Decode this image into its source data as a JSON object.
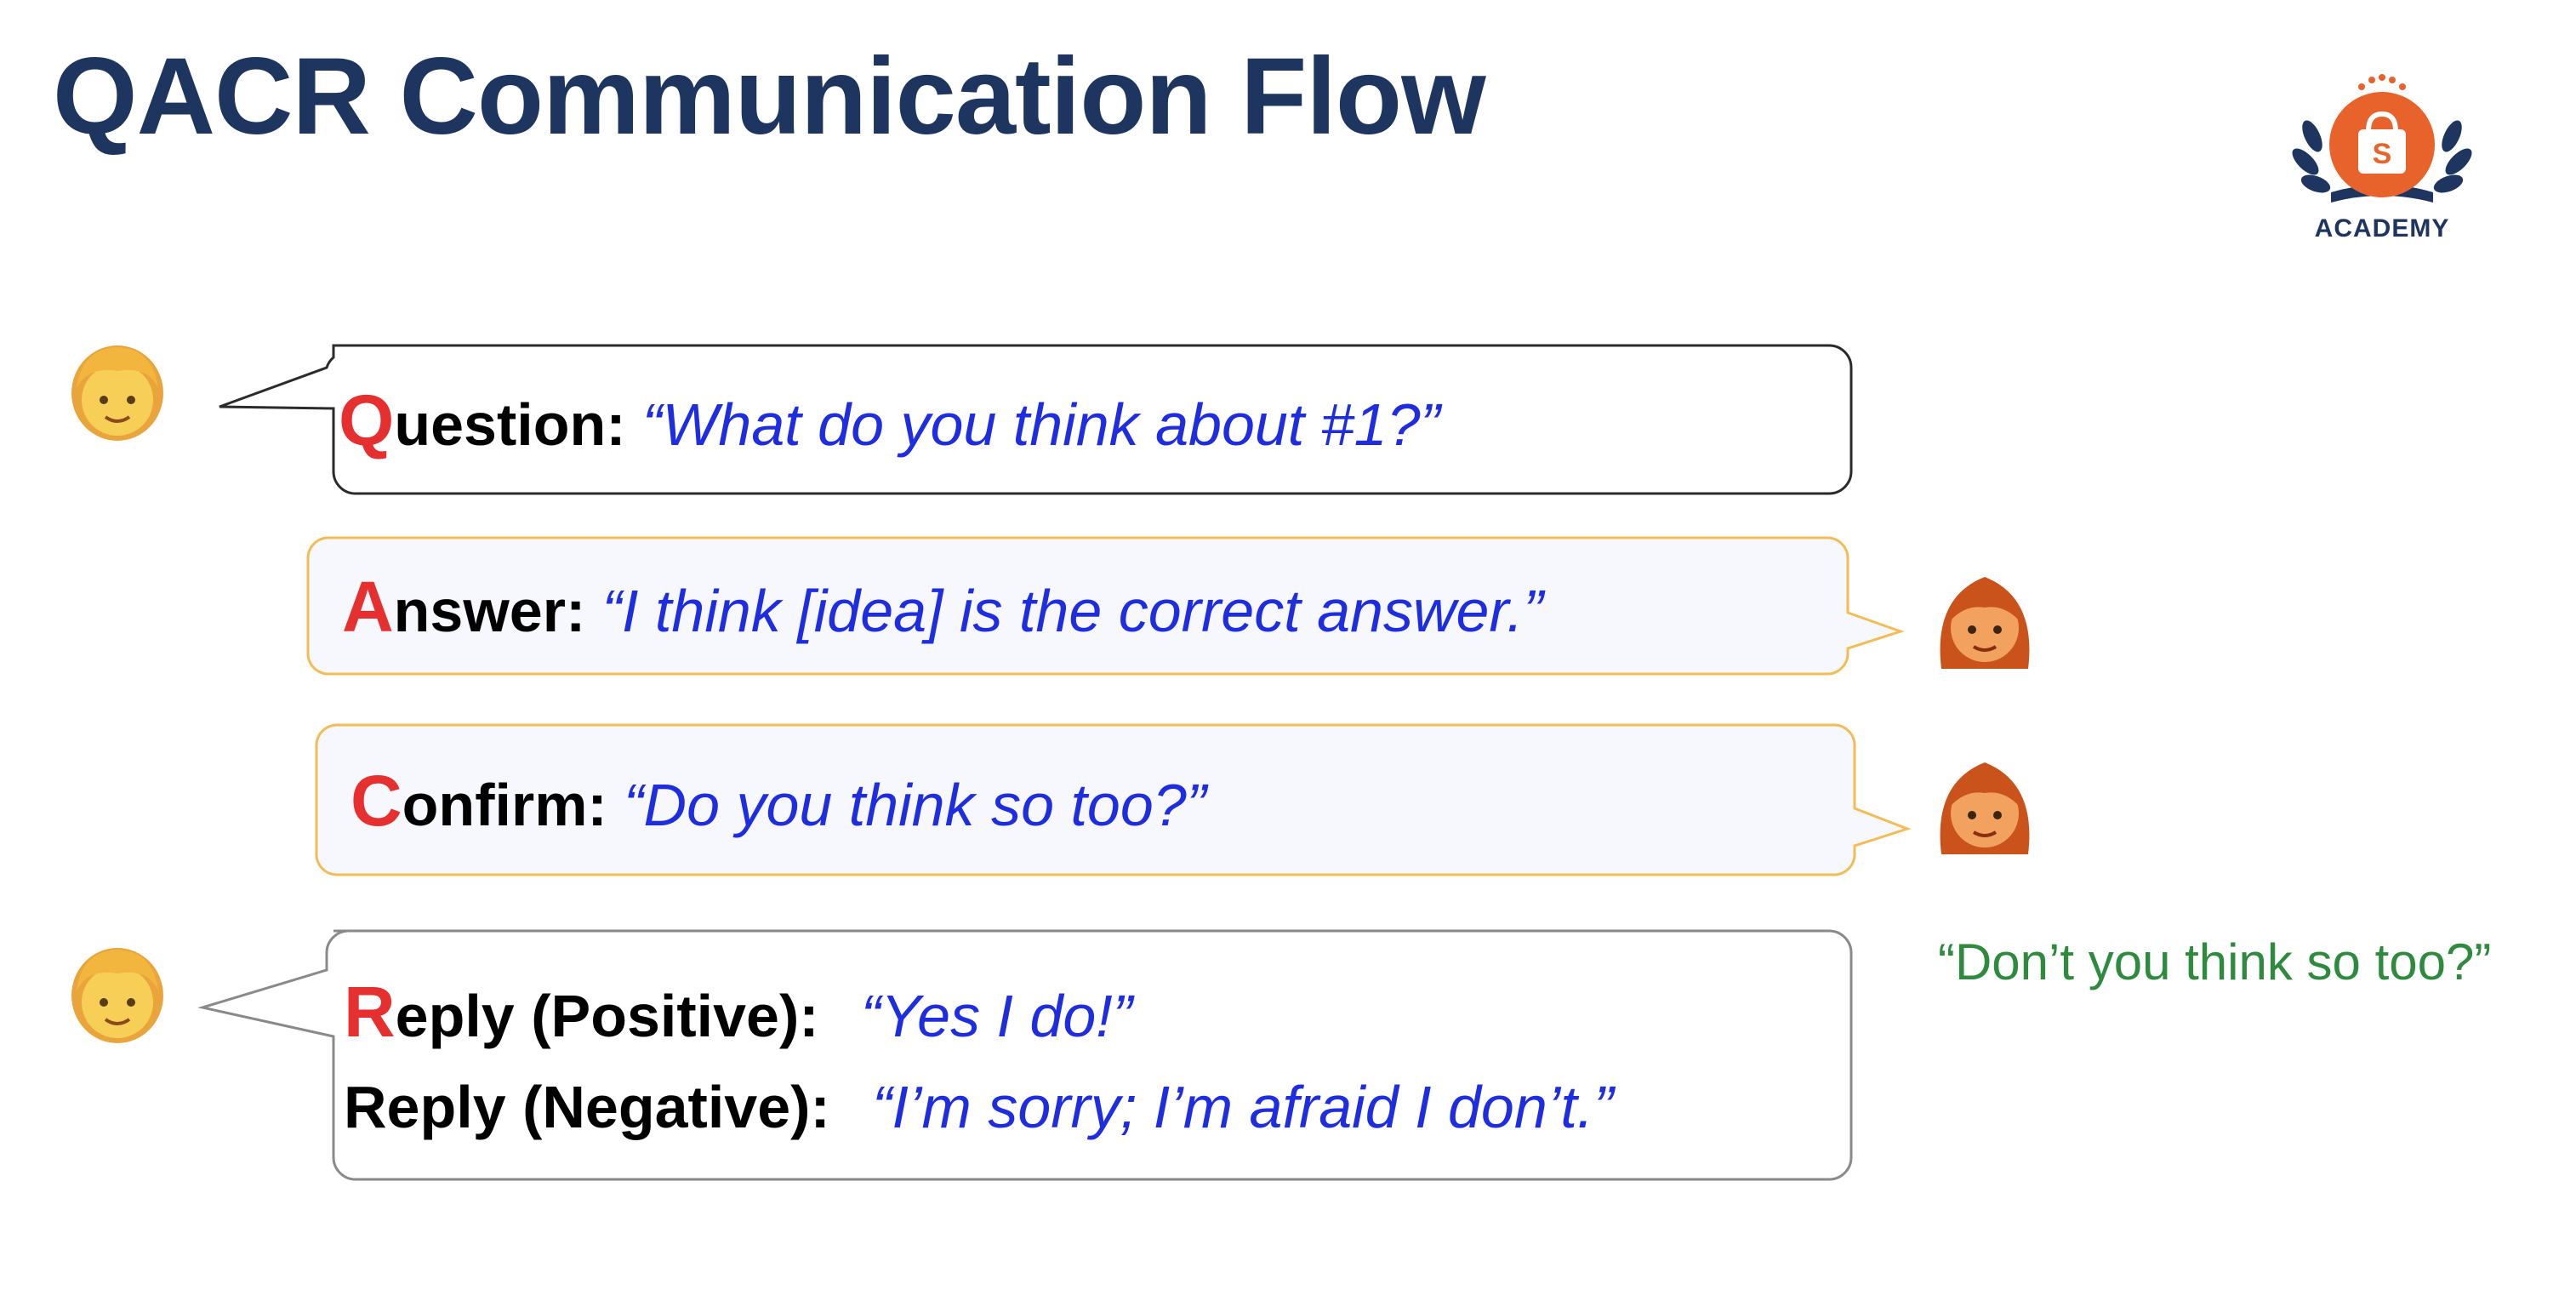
{
  "title": "QACR Communication Flow",
  "logo": {
    "text": "ACADEMY",
    "icon": "shopping-bag-icon",
    "glyph": "S"
  },
  "colors": {
    "title": "#1e3560",
    "initial": "#e62f2f",
    "quote": "#1f2de0",
    "note": "#2e8b3e",
    "question_border": "#2b2b2b",
    "answer_border": "#f2bc56",
    "answer_fill": "#f6f8fd"
  },
  "steps": [
    {
      "initial": "Q",
      "label_rest": "uestion:",
      "quote": "“What do you think about  #1?”",
      "speaker": "child-avatar-icon"
    },
    {
      "initial": "A",
      "label_rest": "nswer:",
      "quote": "“I think [idea] is the correct answer.”",
      "speaker": "woman-avatar-icon"
    },
    {
      "initial": "C",
      "label_rest": "onfirm:",
      "quote": "“Do you think so too?”",
      "speaker": "woman-avatar-icon"
    },
    {
      "initial": "R",
      "label_rest": "eply (Positive):",
      "quote": "“Yes I do!”",
      "second_label": "Reply (Negative):",
      "second_quote": "“I’m sorry; I’m afraid I don’t.”",
      "speaker": "child-avatar-icon"
    }
  ],
  "side_note": "“Don’t you think so too?”"
}
